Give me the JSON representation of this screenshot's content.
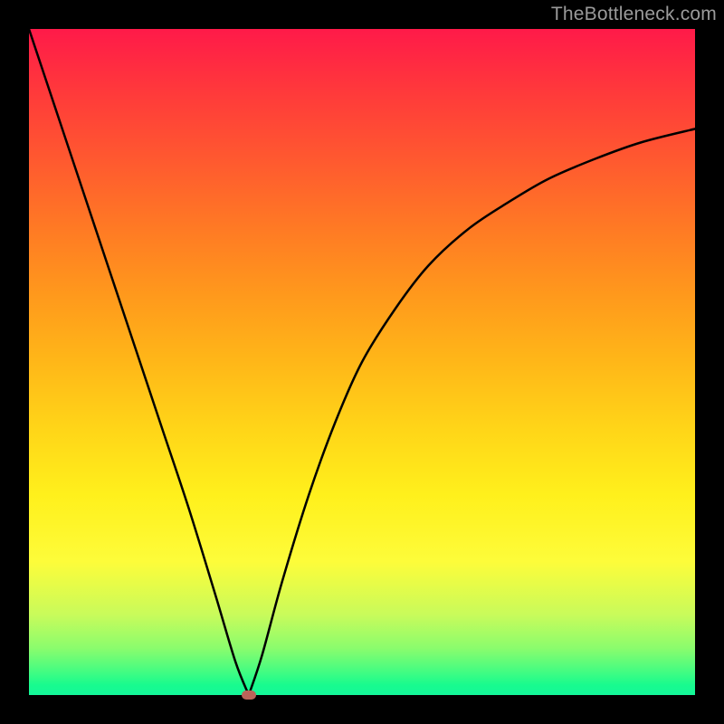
{
  "watermark": "TheBottleneck.com",
  "chart_data": {
    "type": "line",
    "title": "",
    "xlabel": "",
    "ylabel": "",
    "xlim": [
      0,
      100
    ],
    "ylim": [
      0,
      100
    ],
    "grid": false,
    "notes": "Background vertical gradient encodes bottleneck severity: red (high) at top through orange/yellow to green (low) at bottom. The black curve is a V-shaped bottleneck curve whose minimum sits near x≈33 at y≈0.",
    "series": [
      {
        "name": "bottleneck-curve",
        "x": [
          0,
          4,
          8,
          12,
          16,
          20,
          24,
          28,
          31,
          33,
          35,
          38,
          42,
          46,
          50,
          55,
          60,
          66,
          72,
          78,
          85,
          92,
          100
        ],
        "y": [
          100,
          88,
          76,
          64,
          52,
          40,
          28,
          15,
          5,
          0,
          6,
          17,
          30,
          41,
          50,
          58,
          64.5,
          70,
          74,
          77.5,
          80.5,
          83,
          85
        ]
      }
    ],
    "marker": {
      "x": 33,
      "y": 0,
      "color": "#bb6459"
    },
    "gradient_stops": [
      {
        "pos": 0.0,
        "color": "#ff1a49"
      },
      {
        "pos": 0.5,
        "color": "#ffb718"
      },
      {
        "pos": 0.8,
        "color": "#fdfc3a"
      },
      {
        "pos": 1.0,
        "color": "#14f79a"
      }
    ]
  }
}
